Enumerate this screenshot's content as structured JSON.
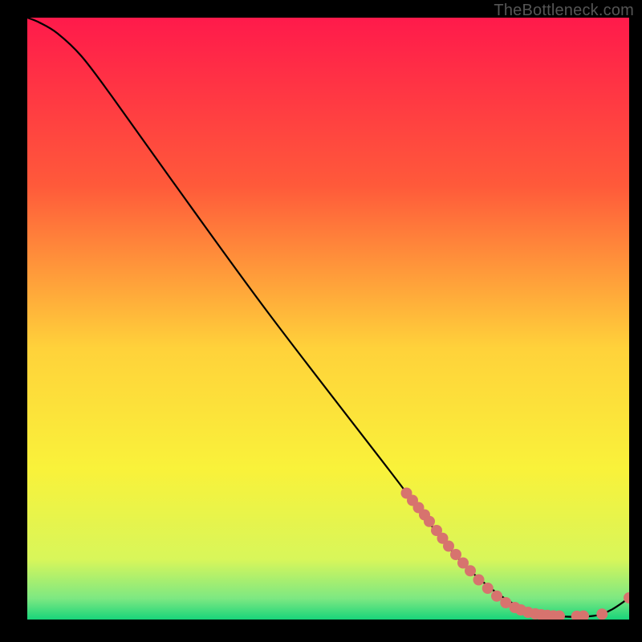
{
  "watermark": "TheBottleneck.com",
  "chart_data": {
    "type": "line",
    "title": "",
    "xlabel": "",
    "ylabel": "",
    "xlim": [
      0,
      100
    ],
    "ylim": [
      0,
      100
    ],
    "gradient_stops": [
      {
        "offset": 0,
        "color": "#ff1a4b"
      },
      {
        "offset": 0.28,
        "color": "#ff5a3a"
      },
      {
        "offset": 0.55,
        "color": "#ffd23a"
      },
      {
        "offset": 0.75,
        "color": "#f9f23a"
      },
      {
        "offset": 0.9,
        "color": "#d8f65a"
      },
      {
        "offset": 0.965,
        "color": "#7de882"
      },
      {
        "offset": 1.0,
        "color": "#18d47a"
      }
    ],
    "series": [
      {
        "name": "curve",
        "type": "line",
        "color": "#000000",
        "points": [
          {
            "x": 0.0,
            "y": 100.0
          },
          {
            "x": 2.0,
            "y": 99.2
          },
          {
            "x": 5.0,
            "y": 97.4
          },
          {
            "x": 9.0,
            "y": 93.6
          },
          {
            "x": 14.0,
            "y": 87.0
          },
          {
            "x": 24.0,
            "y": 73.0
          },
          {
            "x": 40.0,
            "y": 51.0
          },
          {
            "x": 60.0,
            "y": 25.0
          },
          {
            "x": 70.0,
            "y": 12.0
          },
          {
            "x": 76.0,
            "y": 6.0
          },
          {
            "x": 82.0,
            "y": 2.0
          },
          {
            "x": 88.0,
            "y": 0.6
          },
          {
            "x": 94.0,
            "y": 0.6
          },
          {
            "x": 97.0,
            "y": 1.6
          },
          {
            "x": 100.0,
            "y": 3.6
          }
        ]
      },
      {
        "name": "markers",
        "type": "scatter",
        "color": "#d7736e",
        "radius": 7,
        "points": [
          {
            "x": 63.0,
            "y": 21.0
          },
          {
            "x": 64.0,
            "y": 19.8
          },
          {
            "x": 65.0,
            "y": 18.6
          },
          {
            "x": 66.0,
            "y": 17.4
          },
          {
            "x": 66.8,
            "y": 16.3
          },
          {
            "x": 68.0,
            "y": 14.8
          },
          {
            "x": 69.0,
            "y": 13.5
          },
          {
            "x": 70.0,
            "y": 12.2
          },
          {
            "x": 71.2,
            "y": 10.8
          },
          {
            "x": 72.4,
            "y": 9.4
          },
          {
            "x": 73.6,
            "y": 8.1
          },
          {
            "x": 75.0,
            "y": 6.6
          },
          {
            "x": 76.5,
            "y": 5.2
          },
          {
            "x": 78.0,
            "y": 3.9
          },
          {
            "x": 79.5,
            "y": 2.8
          },
          {
            "x": 81.0,
            "y": 2.0
          },
          {
            "x": 82.0,
            "y": 1.6
          },
          {
            "x": 83.2,
            "y": 1.2
          },
          {
            "x": 84.4,
            "y": 0.95
          },
          {
            "x": 85.4,
            "y": 0.8
          },
          {
            "x": 86.4,
            "y": 0.7
          },
          {
            "x": 87.4,
            "y": 0.62
          },
          {
            "x": 88.4,
            "y": 0.58
          },
          {
            "x": 91.3,
            "y": 0.55
          },
          {
            "x": 92.4,
            "y": 0.58
          },
          {
            "x": 95.5,
            "y": 0.9
          },
          {
            "x": 100.0,
            "y": 3.6
          }
        ]
      }
    ]
  }
}
